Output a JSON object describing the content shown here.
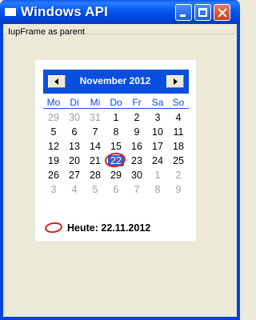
{
  "window": {
    "title": "Windows API"
  },
  "frame": {
    "label": "IupFrame as parent"
  },
  "calendar": {
    "month_label": "November 2012",
    "weekdays": [
      "Mo",
      "Di",
      "Mi",
      "Do",
      "Fr",
      "Sa",
      "So"
    ],
    "weeks": [
      [
        {
          "d": "29",
          "o": true
        },
        {
          "d": "30",
          "o": true
        },
        {
          "d": "31",
          "o": true
        },
        {
          "d": "1"
        },
        {
          "d": "2"
        },
        {
          "d": "3"
        },
        {
          "d": "4"
        }
      ],
      [
        {
          "d": "5"
        },
        {
          "d": "6"
        },
        {
          "d": "7"
        },
        {
          "d": "8"
        },
        {
          "d": "9"
        },
        {
          "d": "10"
        },
        {
          "d": "11"
        }
      ],
      [
        {
          "d": "12"
        },
        {
          "d": "13"
        },
        {
          "d": "14"
        },
        {
          "d": "15"
        },
        {
          "d": "16"
        },
        {
          "d": "17"
        },
        {
          "d": "18"
        }
      ],
      [
        {
          "d": "19"
        },
        {
          "d": "20"
        },
        {
          "d": "21"
        },
        {
          "d": "22",
          "s": true
        },
        {
          "d": "23"
        },
        {
          "d": "24"
        },
        {
          "d": "25"
        }
      ],
      [
        {
          "d": "26"
        },
        {
          "d": "27"
        },
        {
          "d": "28"
        },
        {
          "d": "29"
        },
        {
          "d": "30"
        },
        {
          "d": "1",
          "o": true
        },
        {
          "d": "2",
          "o": true
        }
      ],
      [
        {
          "d": "3",
          "o": true
        },
        {
          "d": "4",
          "o": true
        },
        {
          "d": "5",
          "o": true
        },
        {
          "d": "6",
          "o": true
        },
        {
          "d": "7",
          "o": true
        },
        {
          "d": "8",
          "o": true
        },
        {
          "d": "9",
          "o": true
        }
      ]
    ],
    "today_label": "Heute: 22.11.2012",
    "colors": {
      "header": "#0a4ee0",
      "selected": "#3060d8",
      "today_ring": "#d02020",
      "other_month": "#a0a0a0"
    }
  }
}
